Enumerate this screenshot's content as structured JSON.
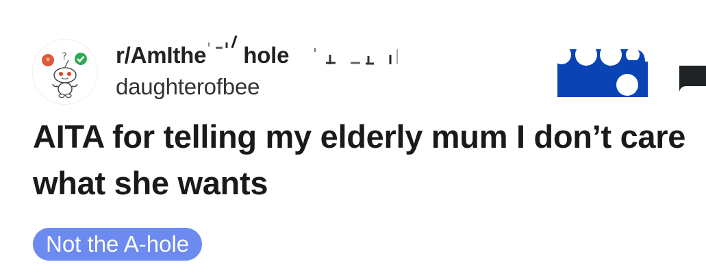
{
  "post": {
    "subreddit": "r/AmIthe",
    "subreddit_tail": "hole",
    "username": "daughterofbee",
    "title": "AITA for telling my elderly mum I don’t care what she wants",
    "flair": "Not the A-hole"
  },
  "icons": {
    "avatar": "snoo-mascot-icon",
    "join": "join-button-icon",
    "more": "more-options-icon"
  },
  "colors": {
    "flair_bg": "#6c8af0",
    "join_blue": "#0a44b4",
    "title_text": "#1a1a1b"
  }
}
